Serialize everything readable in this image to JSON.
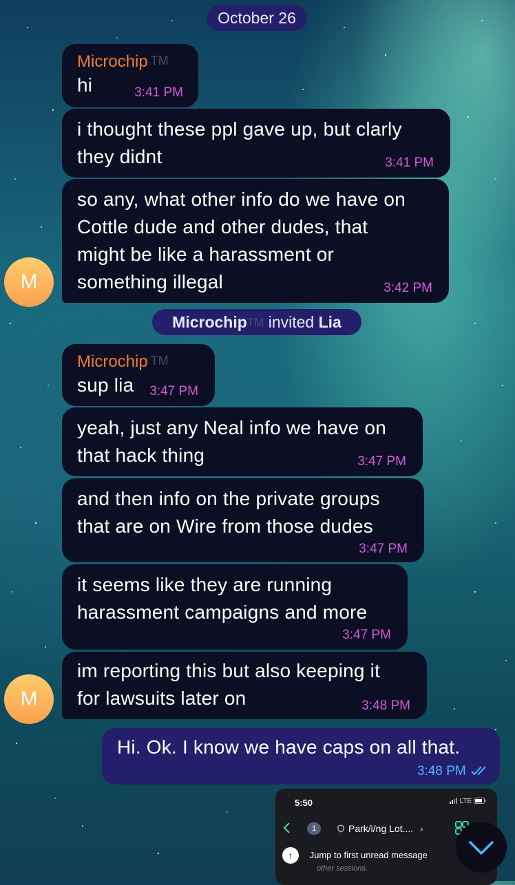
{
  "date_label": "October 26",
  "sender_name": "Microchip",
  "sender_tm": "TM",
  "avatar_letter": "M",
  "messages_group1": [
    {
      "text_lines": [
        "hi"
      ],
      "time": "3:41 PM"
    },
    {
      "text_lines": [
        "i thought these ppl gave up, but clarly",
        "they didnt"
      ],
      "time": "3:41 PM"
    },
    {
      "text_lines": [
        "so any, what other info do we have on",
        "Cottle dude and other dudes, that",
        "might be like  a harassment or",
        "something illegal"
      ],
      "time": "3:42 PM"
    }
  ],
  "service_message": {
    "actor": "Microchip",
    "actor_tm": "TM",
    "verb": "invited",
    "target": "Lia"
  },
  "messages_group2": [
    {
      "text_lines": [
        "sup lia"
      ],
      "time": "3:47 PM"
    },
    {
      "text_lines": [
        "yeah, just any Neal info we have on",
        "that hack thing"
      ],
      "time": "3:47 PM"
    },
    {
      "text_lines": [
        "and then info on the private groups",
        "that are on Wire from those dudes"
      ],
      "time": "3:47 PM"
    },
    {
      "text_lines": [
        "it seems  like they are running",
        "harassment campaigns and more"
      ],
      "time": "3:47 PM"
    },
    {
      "text_lines": [
        "im reporting this but also keeping it",
        "for lawsuits later on"
      ],
      "time": "3:48 PM"
    }
  ],
  "outgoing_message": {
    "text": "Hi. Ok. I know we have caps on all that.",
    "time": "3:48 PM",
    "status_icon": "double-check-icon"
  },
  "embedded_screenshot": {
    "status_time": "5:50",
    "network": "LTE",
    "badge_count": "1",
    "chat_title": "Park/i/ng Lot....",
    "jump_label": "Jump to first unread message",
    "subtext": "other sessions."
  },
  "icons": {
    "scroll_down": "chevron-down-icon"
  },
  "colors": {
    "incoming_bubble": "#0c0f24",
    "outgoing_bubble": "#241f6b",
    "sender_name": "#f07c34",
    "incoming_time": "#d25cd4",
    "outgoing_time": "#52b3ff",
    "avatar": "#fba14d"
  }
}
